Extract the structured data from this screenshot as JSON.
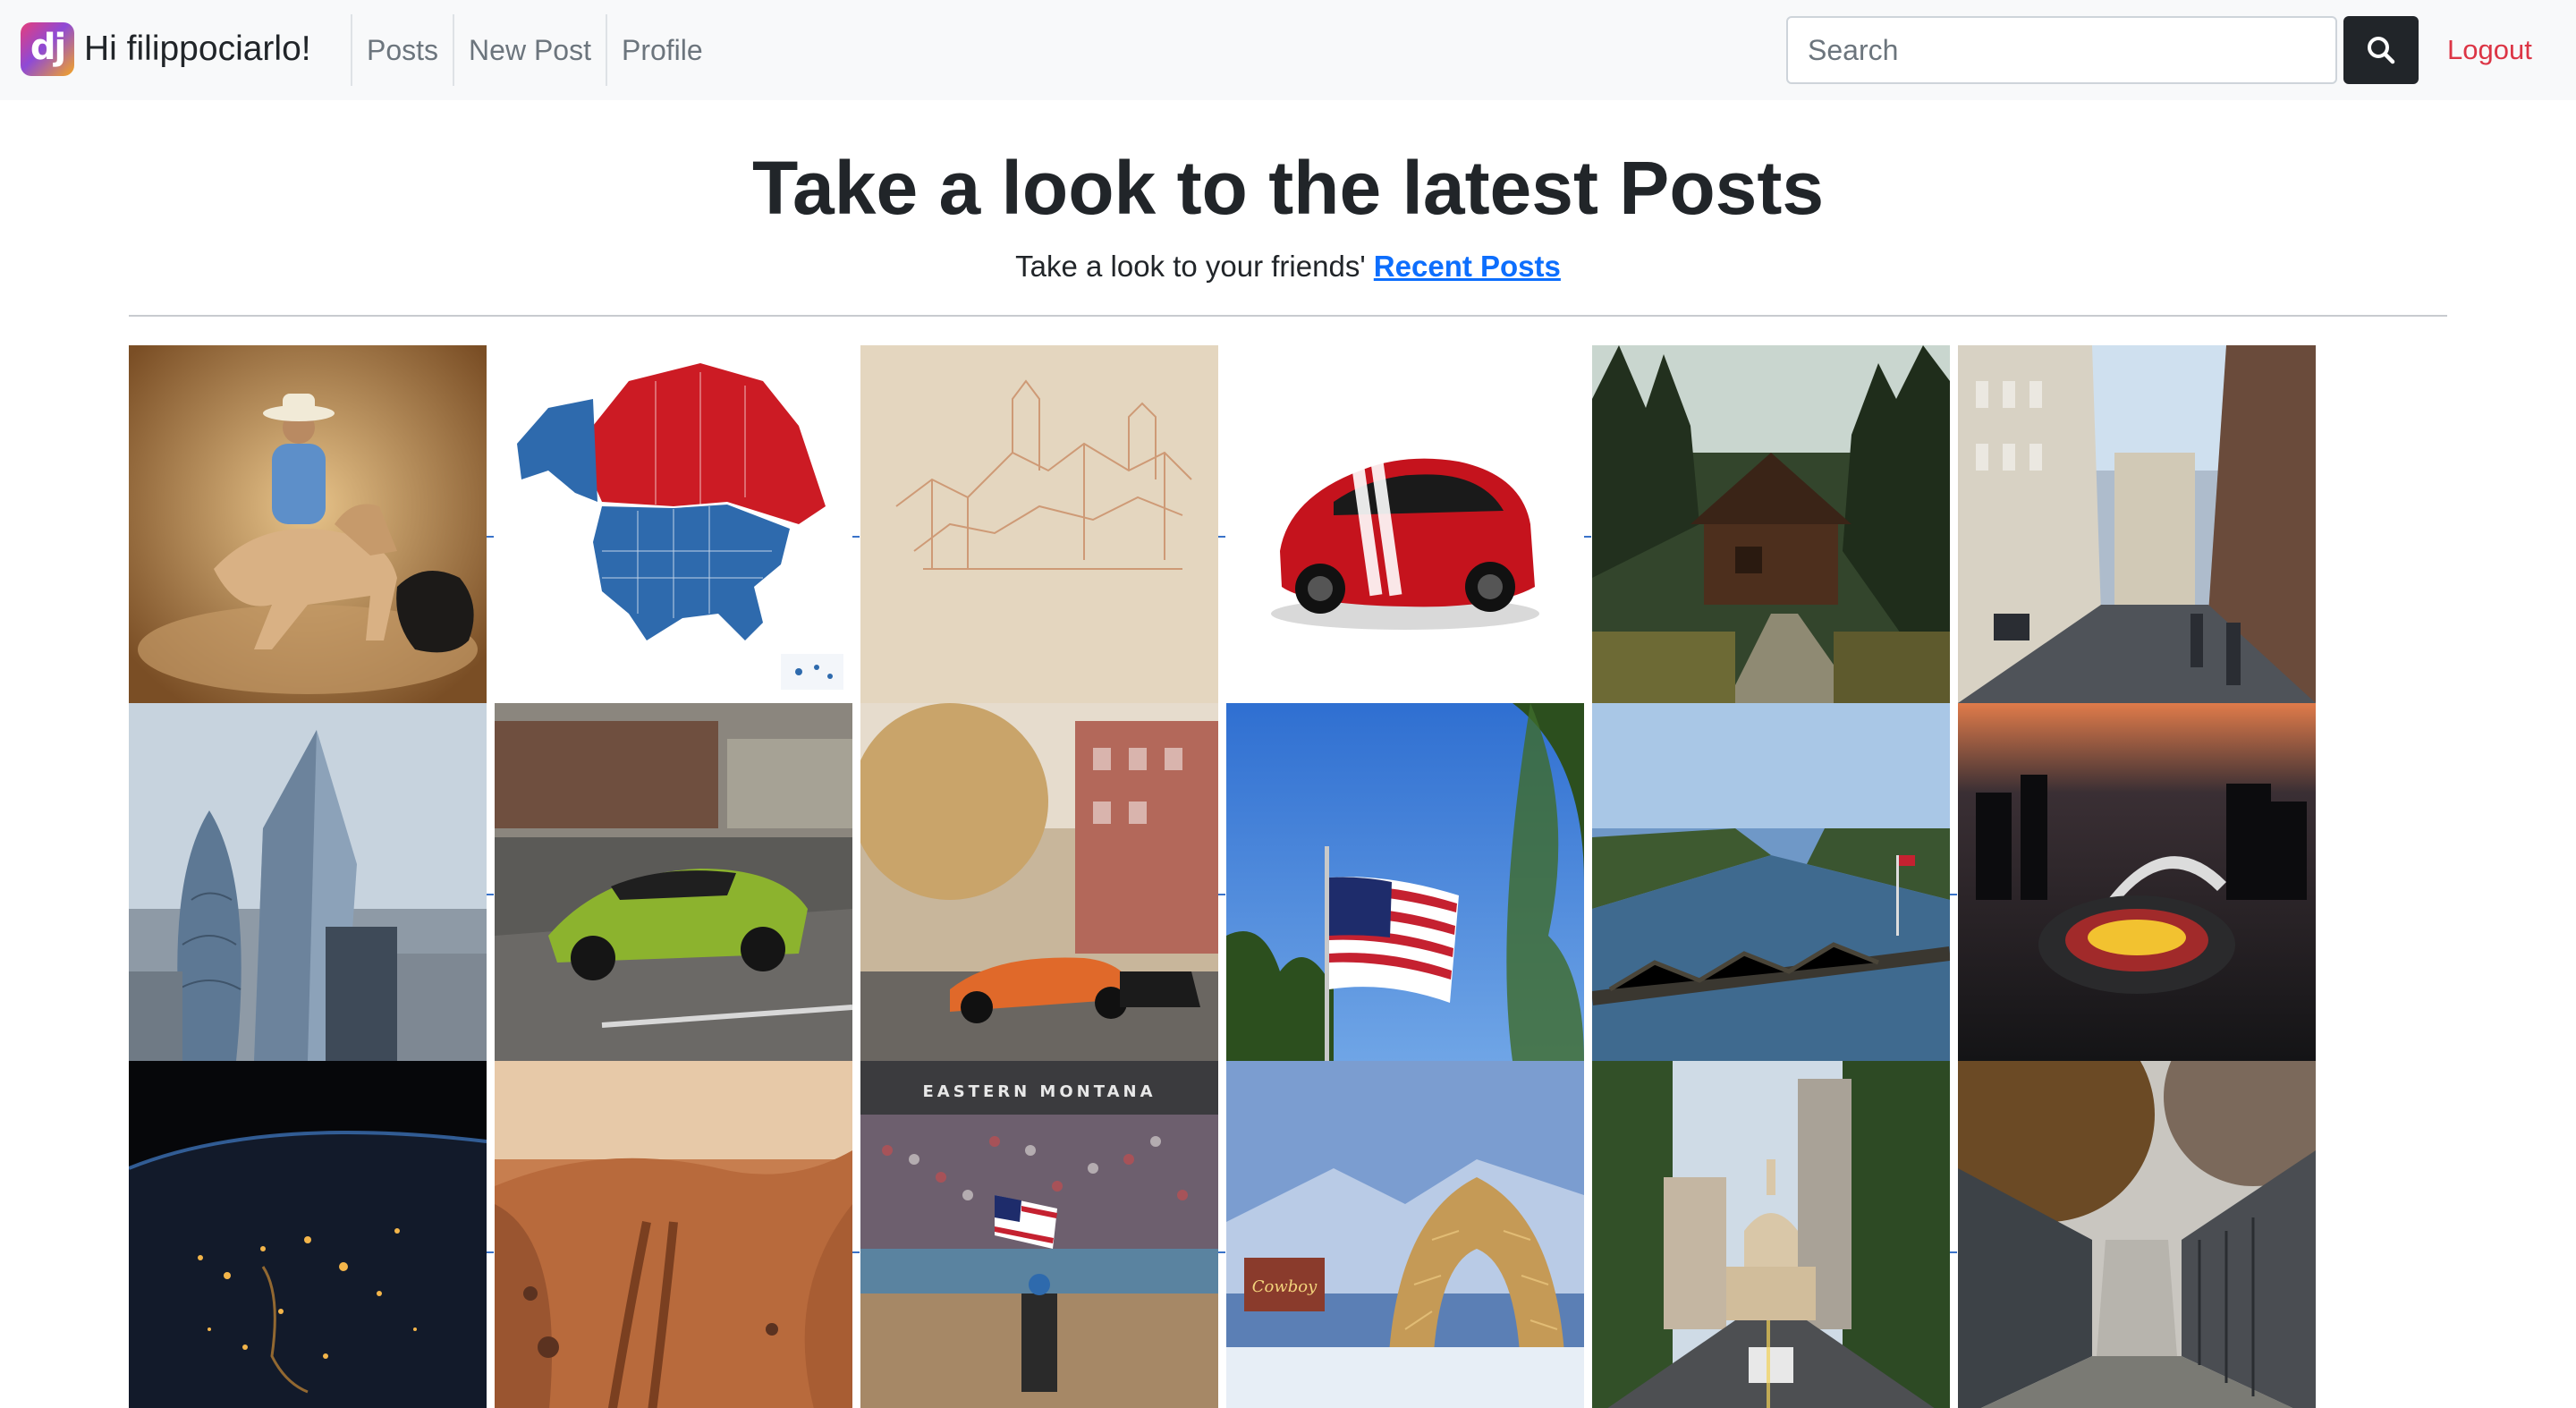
{
  "navbar": {
    "logo_text": "dj",
    "brand": "Hi filippociarlo!",
    "links": [
      "Posts",
      "New Post",
      "Profile"
    ],
    "search": {
      "placeholder": "Search",
      "value": ""
    },
    "search_button_icon": "search-icon",
    "logout": "Logout",
    "colors": {
      "background": "#f8f9fa",
      "logout": "#dc3545",
      "search_button": "#212529"
    }
  },
  "header": {
    "title": "Take a look to the latest Posts",
    "subtitle_prefix": "Take a look to your friends'",
    "subtitle_link": "Recent Posts",
    "link_color": "#0d6efd"
  },
  "gallery": {
    "posts": [
      {
        "subject": "cowboy-on-horse-painting"
      },
      {
        "subject": "north-america-map"
      },
      {
        "subject": "castle-sketch"
      },
      {
        "subject": "red-sports-car"
      },
      {
        "subject": "log-cabin-forest"
      },
      {
        "subject": "city-street"
      },
      {
        "subject": "skyscrapers"
      },
      {
        "subject": "green-supercar"
      },
      {
        "subject": "orange-supercar-street"
      },
      {
        "subject": "american-flag"
      },
      {
        "subject": "river-bridge"
      },
      {
        "subject": "stadium-night"
      },
      {
        "subject": "earth-at-night"
      },
      {
        "subject": "mars-desert"
      },
      {
        "subject": "rodeo-arena"
      },
      {
        "subject": "antler-arch-snow"
      },
      {
        "subject": "capitol-street"
      },
      {
        "subject": "alley-autumn"
      }
    ]
  }
}
